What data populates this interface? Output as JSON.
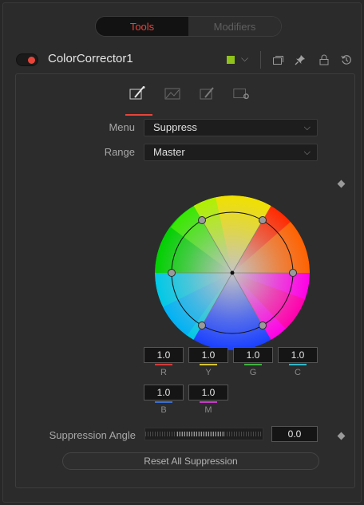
{
  "tabs": [
    {
      "label": "Tools",
      "active": true
    },
    {
      "label": "Modifiers",
      "active": false
    }
  ],
  "header": {
    "node_name": "ColorCorrector1",
    "color_swatch": "#8fc21a",
    "icons": [
      "chevron-down-icon",
      "window-icon",
      "pin-icon",
      "lock-icon",
      "reset-icon"
    ]
  },
  "subtabs": [
    "color-tab-icon",
    "levels-tab-icon",
    "options-tab-icon",
    "settings-tab-icon"
  ],
  "controls": {
    "menu_label": "Menu",
    "menu_value": "Suppress",
    "range_label": "Range",
    "range_value": "Master"
  },
  "channels": [
    {
      "label": "R",
      "value": "1.0",
      "color": "#d43a3a"
    },
    {
      "label": "Y",
      "value": "1.0",
      "color": "#d8c62a"
    },
    {
      "label": "G",
      "value": "1.0",
      "color": "#3fb43f"
    },
    {
      "label": "C",
      "value": "1.0",
      "color": "#2fb8c8"
    },
    {
      "label": "B",
      "value": "1.0",
      "color": "#3a6fd4"
    },
    {
      "label": "M",
      "value": "1.0",
      "color": "#c83ac8"
    }
  ],
  "suppression": {
    "label": "Suppression Angle",
    "value": "0.0",
    "reset_label": "Reset All Suppression"
  },
  "accent": "#e8443a"
}
